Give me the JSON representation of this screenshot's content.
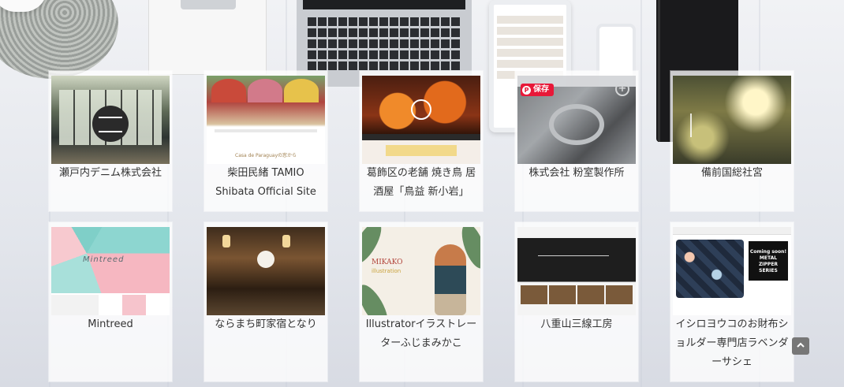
{
  "overlay": {
    "save_label": "保存",
    "save_pin": "P"
  },
  "cards": [
    {
      "title": "瀬戸内デニム株式会社"
    },
    {
      "title": "柴田民緒 TAMIO Shibata Official Site",
      "thumb_caption": "Casa de Paraguayの窓から"
    },
    {
      "title": "葛飾区の老舗 焼き鳥 居酒屋「鳥益 新小岩」"
    },
    {
      "title": "株式会社 粉室製作所"
    },
    {
      "title": "備前国総社宮"
    },
    {
      "title": "Mintreed",
      "thumb_logo": "Mintreed"
    },
    {
      "title": "ならまち町家宿となり"
    },
    {
      "title": "Illustratorイラストレーターふじまみかこ",
      "thumb_name": "MIKAKO",
      "thumb_sub": "illustration"
    },
    {
      "title": "八重山三線工房"
    },
    {
      "title": "イシロヨウコのお財布ショルダー専門店ラベンダーサシェ",
      "thumb_promo": [
        "Coming soon!",
        "METAL",
        "ZIPPER",
        "SERIES"
      ]
    }
  ],
  "icons": {
    "zoom": "plus-circle-icon",
    "back_to_top": "chevron-up-icon"
  }
}
